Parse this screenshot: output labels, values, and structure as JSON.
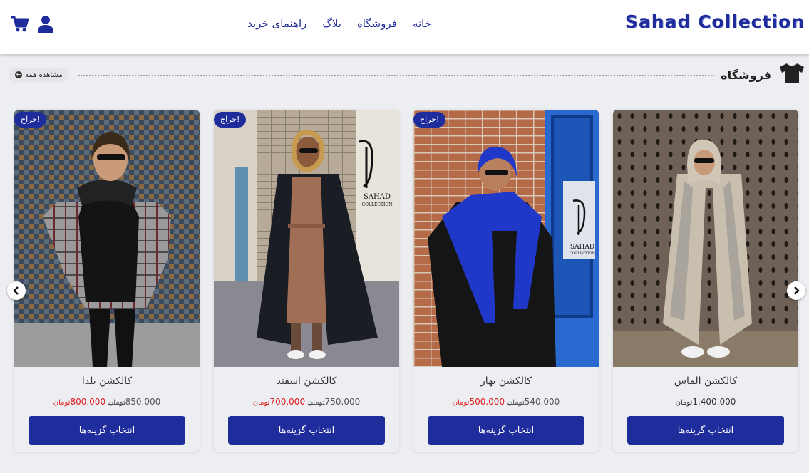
{
  "header": {
    "logo": "Sahad Collection",
    "nav": [
      {
        "label": "خانه"
      },
      {
        "label": "فروشگاه"
      },
      {
        "label": "بلاگ"
      },
      {
        "label": "راهنمای خرید"
      }
    ]
  },
  "icons": {
    "cart": "shopping-cart-icon",
    "user": "user-icon",
    "section": "t-shirt-icon",
    "prev": "chevron-left-icon",
    "next": "chevron-right-icon"
  },
  "section": {
    "title": "فروشگاه",
    "view_all": "مشاهده همه"
  },
  "colors": {
    "brand": "#1f2c9c",
    "sale_price": "#e02020",
    "page_bg": "#eceef1"
  },
  "products": [
    {
      "name": "کالکشن الماس",
      "sale_badge": "",
      "old_price": "",
      "price": "1.400.000",
      "unit": "تومان",
      "button": "انتخاب گزینه‌ها"
    },
    {
      "name": "کالکشن بهار",
      "sale_badge": "حراج!",
      "old_price": "540.000",
      "price": "500.000",
      "unit": "تومان",
      "button": "انتخاب گزینه‌ها"
    },
    {
      "name": "کالکشن اسفند",
      "sale_badge": "حراج!",
      "old_price": "750.000",
      "price": "700.000",
      "unit": "تومان",
      "button": "انتخاب گزینه‌ها"
    },
    {
      "name": "کالکشن یلدا",
      "sale_badge": "حراج!",
      "old_price": "850.000",
      "price": "800.000",
      "unit": "تومان",
      "button": "انتخاب گزینه‌ها"
    }
  ]
}
